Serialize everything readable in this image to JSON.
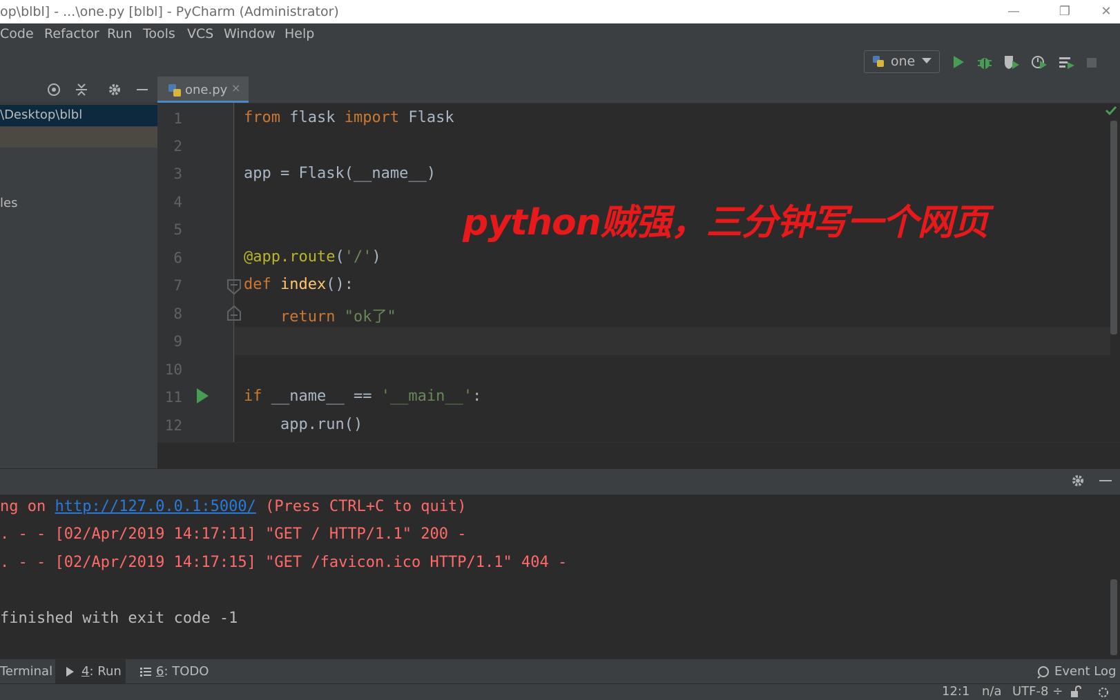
{
  "window": {
    "title": "op\\blbl] - ...\\one.py [blbl] - PyCharm (Administrator)",
    "minimize": "—",
    "restore": "❐",
    "close": "✕"
  },
  "menu": {
    "items": [
      "Code",
      "Refactor",
      "Run",
      "Tools",
      "VCS",
      "Window",
      "Help"
    ]
  },
  "toolbar": {
    "run_config": "one"
  },
  "project": {
    "root_label": "\\Desktop\\blbl",
    "external_label": "les"
  },
  "editor": {
    "tab_label": "one.py",
    "tab_close": "×",
    "line_numbers": [
      "1",
      "2",
      "3",
      "4",
      "5",
      "6",
      "7",
      "8",
      "9",
      "10",
      "11",
      "12"
    ],
    "code": {
      "l1_kw1": "from",
      "l1_mod": " flask ",
      "l1_kw2": "import",
      "l1_name": " Flask",
      "l3": "app = Flask(__name__)",
      "l6_dec": "@app.route",
      "l6_open": "(",
      "l6_str": "'/'",
      "l6_close": ")",
      "l7_kw": "def",
      "l7_fn": " index",
      "l7_rest": "():",
      "l8_indent": "    ",
      "l8_kw": "return",
      "l8_str": " \"ok了\"",
      "l11_kw": "if",
      "l11_mid": " __name__ == ",
      "l11_str": "'__main__'",
      "l11_end": ":",
      "l12": "    app.run()"
    },
    "overlay_caption": "python贼强，三分钟写一个网页"
  },
  "console": {
    "line1_pre": "ng on ",
    "line1_link": "http://127.0.0.1:5000/",
    "line1_post": " (Press CTRL+C to quit)",
    "line2": ". - - [02/Apr/2019 14:17:11] \"GET / HTTP/1.1\" 200 -",
    "line3": ". - - [02/Apr/2019 14:17:15] \"GET /favicon.ico HTTP/1.1\" 404 -",
    "line4": "finished with exit code -1"
  },
  "bottom_tabs": {
    "terminal": "Terminal",
    "run_num": "4",
    "run": ": Run",
    "todo_num": "6",
    "todo": ": TODO",
    "event_log": "Event Log"
  },
  "status": {
    "position": "12:1",
    "na": "n/a",
    "encoding": "UTF-8 ÷"
  },
  "colors": {
    "keyword": "#cc7832",
    "string": "#6a8759",
    "decorator": "#bbb529",
    "function": "#ffc66d",
    "error_text": "#ff6b68",
    "caption": "#e8191a"
  }
}
